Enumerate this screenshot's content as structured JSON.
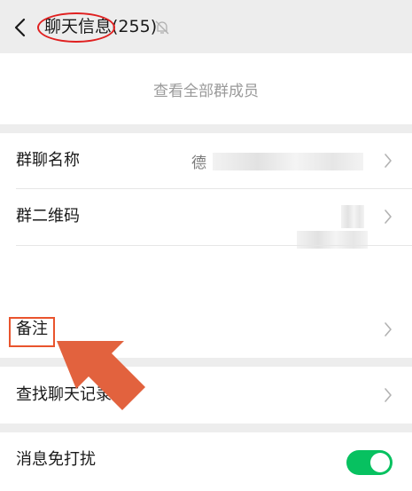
{
  "header": {
    "title": "聊天信息",
    "member_count": "(255)",
    "back_icon": "chevron-left-icon",
    "mute_icon": "bell-off-icon"
  },
  "members": {
    "view_all_label": "查看全部群成员"
  },
  "settings": {
    "group_name_label": "群聊名称",
    "group_name_value": "德",
    "qr_code_label": "群二维码",
    "remark_label": "备注",
    "search_label": "查找聊天记录",
    "do_not_disturb_label": "消息免打扰",
    "do_not_disturb_on": true
  },
  "colors": {
    "toggle_on": "#07c160",
    "annotation_red": "#e02020",
    "annotation_orange": "#e9542d"
  }
}
